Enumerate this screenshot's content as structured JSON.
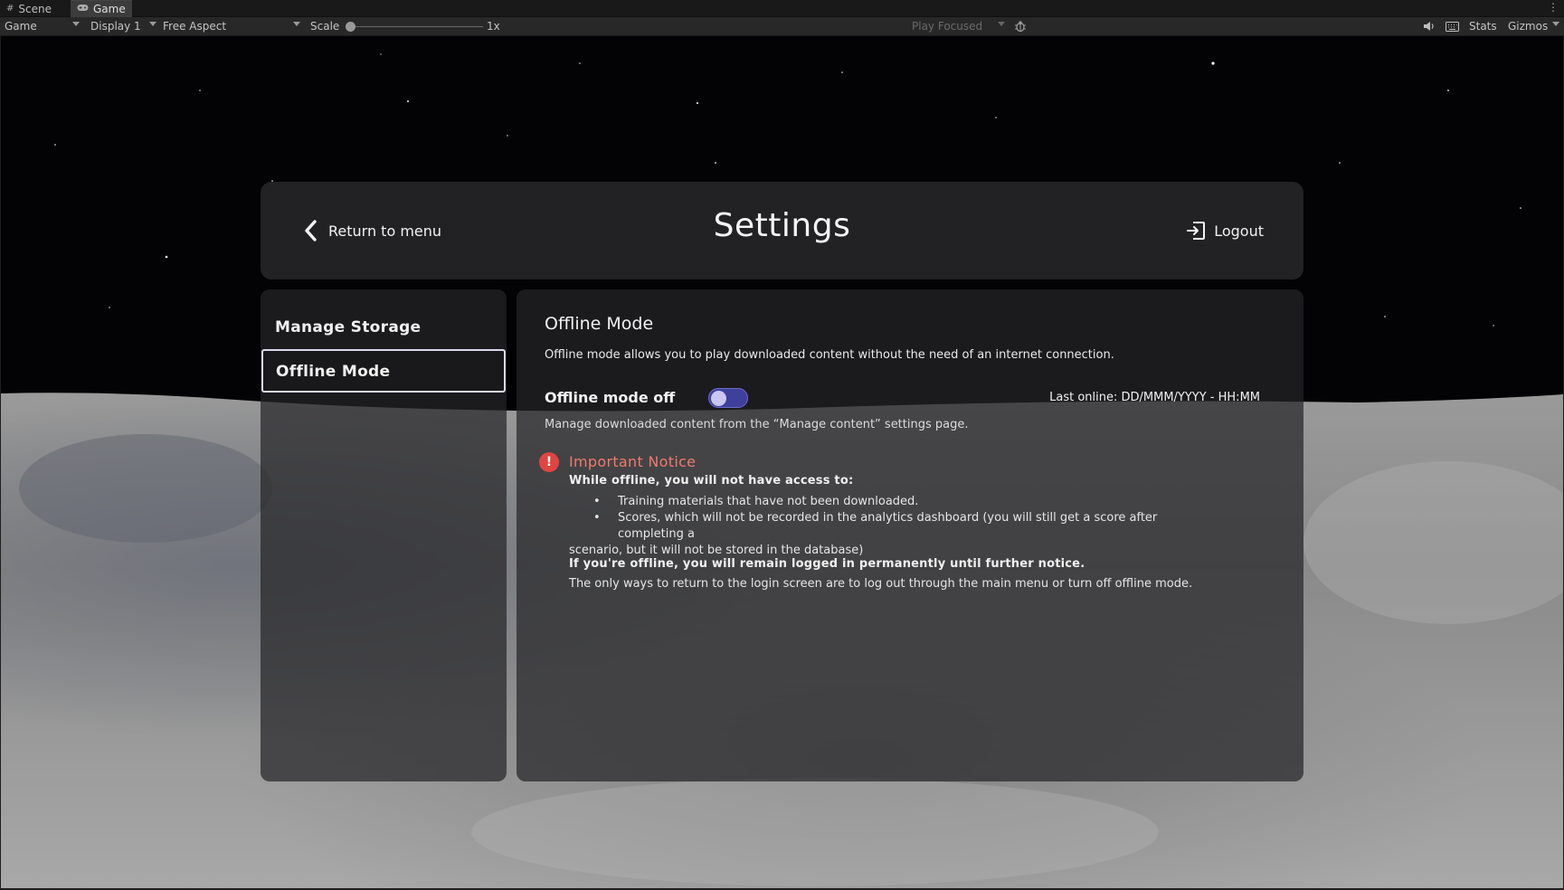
{
  "editor": {
    "tabs": [
      {
        "label": "Scene",
        "icon": "grid-icon"
      },
      {
        "label": "Game",
        "icon": "gamepad-icon"
      }
    ],
    "toolbar": {
      "view_select": "Game",
      "display_select": "Display 1",
      "aspect_select": "Free Aspect",
      "scale_label": "Scale",
      "scale_value": "1x",
      "scale_level": 0,
      "play_mode_select": "Play Focused",
      "stats_label": "Stats",
      "gizmos_label": "Gizmos"
    }
  },
  "settings": {
    "header": {
      "back_label": "Return to menu",
      "title": "Settings",
      "logout_label": "Logout"
    },
    "sidebar": {
      "items": [
        {
          "label": "Manage Storage",
          "selected": false
        },
        {
          "label": "Offline Mode",
          "selected": true
        }
      ]
    },
    "panel": {
      "title": "Offline Mode",
      "description": "Offline mode allows you to play downloaded content without the need of an internet connection.",
      "toggle_label": "Offline mode off",
      "toggle_on": false,
      "last_online": "Last online: DD/MMM/YYYY - HH:MM",
      "manage_note": "Manage downloaded content from the “Manage content” settings page.",
      "notice": {
        "icon": "!",
        "title": "Important Notice",
        "heading": "While offline, you will not have access to:",
        "bullets": [
          "Training materials that have not been downloaded.",
          "Scores, which will not be recorded in the analytics dashboard (you will still get a score after completing a",
          "scenario, but it will not be stored in the database)"
        ],
        "permanent": "If you're offline, you will remain logged in permanently until further notice.",
        "ways": "The only ways to return to the login screen are to log out through the main menu or turn off offline mode."
      }
    }
  },
  "colors": {
    "accent_toggle": "#3f3f9c",
    "notice_red": "#e0453f",
    "notice_text": "#f07a6c"
  }
}
